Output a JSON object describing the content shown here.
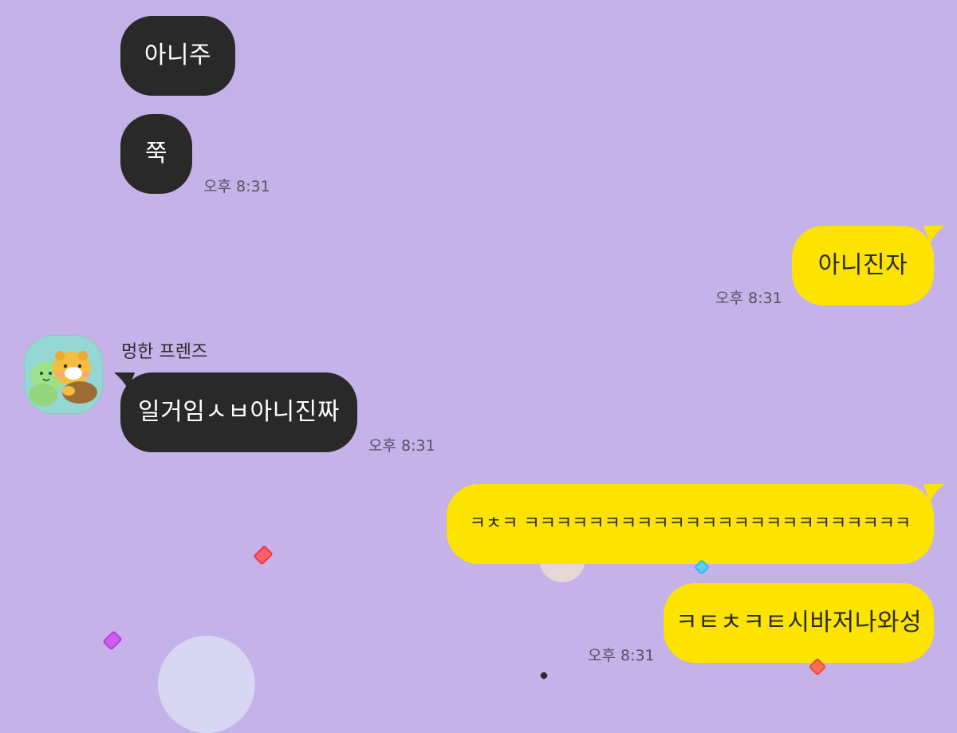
{
  "messages": [
    {
      "side": "other",
      "text": "아니주"
    },
    {
      "side": "other",
      "text": "쭉",
      "time": "오후 8:31"
    },
    {
      "side": "mine",
      "text": "아니진자",
      "time": "오후 8:31"
    },
    {
      "side": "other",
      "sender": "멍한 프렌즈",
      "text": "일거임ㅅㅂ아니진짜",
      "time": "오후 8:31"
    },
    {
      "side": "mine",
      "text": "ㅋㅊㅋ ㅋㅋㅋㅋㅋㅋㅋㅋㅋㅋㅋㅋㅋㅋㅋㅋㅋㅋㅋㅋㅋㅋㅋㅋ"
    },
    {
      "side": "mine",
      "text": "ㅋㅌㅊㅋㅌ시바저나와성",
      "time": "오후 8:31"
    }
  ],
  "colors": {
    "background": "#c5b2e8",
    "other_bubble": "#292929",
    "mine_bubble": "#fde300"
  },
  "icons": {
    "avatar": "friends-avatar-icon",
    "confetti": "confetti-effect"
  }
}
